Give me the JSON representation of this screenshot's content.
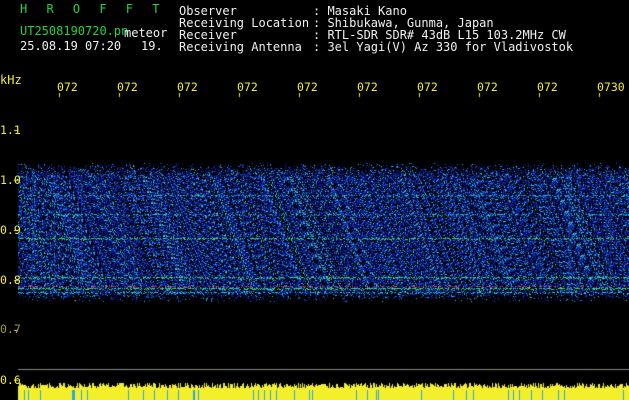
{
  "header": {
    "program": "H R O F F T",
    "filename": "UT2508190720.pn",
    "mode": "meteor",
    "datetime": "25.08.19 07:20",
    "count": "19."
  },
  "station": {
    "labels": [
      "Observer",
      "Receiving Location",
      "Receiver",
      "Receiving Antenna"
    ],
    "values": [
      ": Masaki Kano",
      ": Shibukawa, Gunma, Japan",
      ": RTL-SDR SDR# 43dB L15 103.2MHz CW",
      ": 3el Yagi(V) Az 330 for Vladivostok"
    ]
  },
  "axes": {
    "y_unit": "kHz",
    "y_ticks": [
      "1.1",
      "1.0",
      "0.9",
      "0.8",
      "0.7",
      "0.6"
    ],
    "x_ticks": [
      "072",
      "072",
      "072",
      "072",
      "072",
      "072",
      "072",
      "072",
      "072",
      "0730"
    ]
  },
  "colors": {
    "text_green": "#25d33a",
    "text_yellow": "#f3ef2a",
    "text_white": "#f0f0f0",
    "background": "#000000"
  }
}
